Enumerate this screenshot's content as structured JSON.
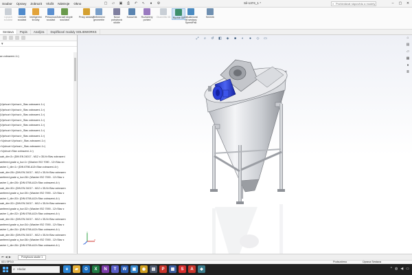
{
  "menu": {
    "items": [
      "Soubor",
      "Úpravy",
      "Zobrazit",
      "Vložit",
      "Nástroje",
      "Okno"
    ]
  },
  "window": {
    "title": "Sil-1374_1 *",
    "search_placeholder": "Prohledávat nápovědu a modely"
  },
  "ribbon": {
    "buttons": [
      {
        "label": "Upravit součást",
        "icon": "edit-component-icon",
        "color": "#c9cfd6",
        "disabled": true
      },
      {
        "label": "Umístit součást",
        "icon": "insert-component-icon",
        "color": "#4f8acb"
      },
      {
        "label": "Inteligentní šrouby",
        "icon": "smart-fasteners-icon",
        "color": "#e2a33a"
      },
      {
        "label": "Přesunout součást",
        "icon": "move-component-icon",
        "color": "#5b8fcf"
      },
      {
        "label": "Zobrazit skryté součásti",
        "icon": "show-hidden-icon",
        "color": "#6a9a4c"
      },
      {
        "label": "Prvky sestavy",
        "icon": "assembly-features-icon",
        "color": "#d4a030"
      },
      {
        "label": "Referenční geometrie",
        "icon": "reference-geometry-icon",
        "color": "#7a9fc8"
      },
      {
        "label": "Nová pohybová studie",
        "icon": "motion-study-icon",
        "color": "#7f7f9f"
      },
      {
        "label": "Kusovník",
        "icon": "bom-icon",
        "color": "#5a84b0"
      },
      {
        "label": "Rozložený pohled",
        "icon": "exploded-view-icon",
        "color": "#9a7ac0"
      },
      {
        "label": "Okamžitá 3D",
        "icon": "instant3d-icon",
        "color": "#c9cfd6",
        "disabled": true
      },
      {
        "label": "Rychlé 3D",
        "icon": "speedpak-icon",
        "color": "#3d8f6b",
        "active": true
      },
      {
        "label": "Aktualizovat díl sestavy SpeedPak",
        "icon": "update-speedpak-icon",
        "color": "#4a8ac0"
      },
      {
        "label": "Snímek",
        "icon": "snapshot-icon",
        "color": "#6f8fb0"
      }
    ]
  },
  "tabs": [
    "Sestava",
    "Popis",
    "Analýza",
    "Doplňkové moduly SOLIDWORKS"
  ],
  "tree": {
    "items": [
      "(Výchozí<Výchozí>_Stav zobrazení-1>)",
      "(Výchozí<Výchozí>_Stav zobrazení-1>)",
      "(Výchozí<Výchozí>_Stav zobrazení-1>)",
      "(Výchozí<Výchozí>_Stav zobrazení-1>)",
      "(Výchozí<Výchozí>_Stav zobrazení-1>)",
      "(Výchozí<Výchozí>_Stav zobrazení-1>)",
      "(Výchozí<Výchozí>_Stav zobrazení-1>)",
      "<Výchozí<Výchozí>_Stav zobrazení-1>)",
      "<Výchozí<Výchozí>_Stav zobrazení-1>)",
      "<Výchozí<Stav zobrazení-1>)",
      "uab_din<3> (DIN EN 24017 - M12 x 35-N<Stav zobrazení",
      "amfered grade a_iso<1> (Washer ISO 7090 - 12<Stav zo",
      "asher 1_din<1> (DIN 6798-A13<Stav zobrazení-4>)",
      "uab_din<28> (DIN EN 24017 - M12 x 35-N<Stav zobrazen",
      "amfered grade a_iso<28> (Washer ISO 7090 - 12<Stav z",
      "asher 1_din<28> (DIN 6798-A13<Stav zobrazení-4>)",
      "uab_din<30> (DIN EN 24017 - M12 x 35-N<Stav zobrazen",
      "amfered grade a_iso<30> (Washer ISO 7090 - 12<Stav z",
      "asher 1_din<30> (DIN 6798-A13<Stav zobrazení-4>)",
      "uab_din<32> (DIN EN 24017 - M12 x 35-N<Stav zobrazen",
      "amfered grade a_iso<32> (Washer ISO 7090 - 12<Stav z",
      "asher 1_din<32> (DIN 6798-A13<Stav zobrazení-4>)",
      "uab_din<34> (DIN EN 24017 - M12 x 35-N<Stav zobrazen",
      "amfered grade a_iso<34> (Washer ISO 7090 - 12<Stav z",
      "asher 1_din<34> (DIN 6798-A13<Stav zobrazení-4>)",
      "uab_din<36> (DIN EN 24017 - M12 x 35-N<Stav zobrazen",
      "amfered grade a_iso<36> (Washer ISO 7090 - 12<Stav z",
      "asher 1_din<36> (DIN 6798-A13<Stav zobrazení-4>)"
    ],
    "header_item": "av zobrazení-1>)"
  },
  "model_tab": {
    "label": "Pohybová studie 1"
  },
  "status": {
    "version": "021 SP3.0",
    "state": "Podsurčeno",
    "mode": "Úprava Sestava"
  },
  "taskbar": {
    "search_placeholder": "Hledat",
    "apps": [
      {
        "icon": "edge-icon",
        "color": "#2b86d6",
        "glyph": "e"
      },
      {
        "icon": "file-explorer-icon",
        "color": "#e8b23a",
        "glyph": "▰"
      },
      {
        "icon": "outlook-icon",
        "color": "#1a6fc0",
        "glyph": "O"
      },
      {
        "icon": "excel-icon",
        "color": "#1f7a43",
        "glyph": "X"
      },
      {
        "icon": "onenote-icon",
        "color": "#7b3ba8",
        "glyph": "N"
      },
      {
        "icon": "teams-icon",
        "color": "#5a5ec8",
        "glyph": "T"
      },
      {
        "icon": "word-icon",
        "color": "#2b5cb4",
        "glyph": "W"
      },
      {
        "icon": "photos-icon",
        "color": "#3a8ad0",
        "glyph": "▣"
      },
      {
        "icon": "chrome-icon",
        "color": "#d0a020",
        "glyph": "◉"
      },
      {
        "icon": "store-icon",
        "color": "#505b70",
        "glyph": "▤"
      },
      {
        "icon": "pdf-icon",
        "color": "#c8342b",
        "glyph": "P"
      },
      {
        "icon": "app-icon",
        "color": "#3e5fa0",
        "glyph": "▦"
      },
      {
        "icon": "solidworks-icon",
        "color": "#d62d2d",
        "glyph": "S"
      },
      {
        "icon": "acrobat-icon",
        "color": "#c8342b",
        "glyph": "A"
      },
      {
        "icon": "app2-icon",
        "color": "#3a7a8a",
        "glyph": "◆"
      }
    ]
  }
}
